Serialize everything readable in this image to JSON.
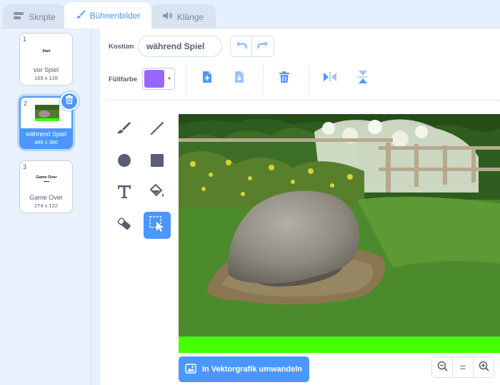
{
  "tabs": [
    {
      "label": "Skripte",
      "icon": "code-icon"
    },
    {
      "label": "Bühnenbilder",
      "icon": "paintbrush-icon"
    },
    {
      "label": "Klänge",
      "icon": "speaker-icon"
    }
  ],
  "costumes": [
    {
      "number": "1",
      "thumb_text": "Start",
      "name": "vor Spiel",
      "size": "169 x 128"
    },
    {
      "number": "2",
      "thumb_text": "",
      "name": "während Spiel",
      "size": "480 x 360"
    },
    {
      "number": "3",
      "thumb_text": "Game Over",
      "name": "Game Over",
      "size": "274 x 122"
    }
  ],
  "editor": {
    "costume_label": "Kostüm",
    "costume_name": "während Spiel",
    "fill_label": "Füllfarbe",
    "fill_color": "#9966ff",
    "convert_button": "In Vektorgrafik umwandeln",
    "zoom_reset": "="
  },
  "colors": {
    "accent": "#4c97ff",
    "green_bar": "#44ff00"
  }
}
